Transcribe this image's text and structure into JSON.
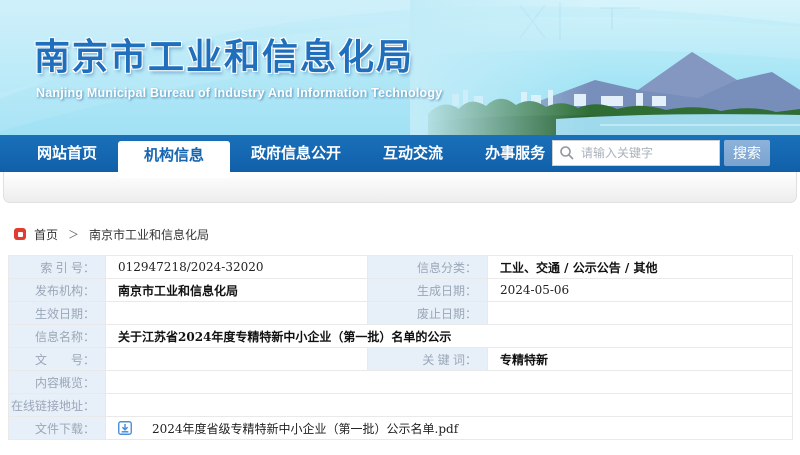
{
  "header": {
    "title": "南京市工业和信息化局",
    "subtitle": "Nanjing Municipal Bureau of Industry And Information Technology"
  },
  "nav": {
    "items": [
      "网站首页",
      "机构信息",
      "政府信息公开",
      "互动交流",
      "办事服务"
    ],
    "active_item": "机构信息",
    "search_placeholder": "请输入关键字",
    "search_button": "搜索"
  },
  "breadcrumb": {
    "home": "首页",
    "separator": "＞",
    "current": "南京市工业和信息化局"
  },
  "record": {
    "labels": {
      "index": "索 引 号：",
      "category": "信息分类：",
      "publisher": "发布机构：",
      "created": "生成日期：",
      "effective": "生效日期：",
      "expiry": "废止日期：",
      "title": "信息名称：",
      "doc_no": "文　　号：",
      "keywords": "关 键 词：",
      "summary": "内容概览：",
      "link": "在线链接地址：",
      "download": "文件下载："
    },
    "values": {
      "index": "012947218/2024-32020",
      "category": "工业、交通 / 公示公告 / 其他",
      "publisher": "南京市工业和信息化局",
      "created": "2024-05-06",
      "effective": "",
      "expiry": "",
      "title": "关于江苏省2024年度专精特新中小企业（第一批）名单的公示",
      "doc_no": "",
      "keywords": "专精特新",
      "summary": "",
      "link": "",
      "download_file": "2024年度省级专精特新中小企业（第一批）公示名单.pdf"
    }
  },
  "colors": {
    "nav_blue": "#1565b0",
    "label_cell_bg": "#e7eff8",
    "label_text": "#9aa7b8",
    "accent_red": "#e23b31",
    "download_icon_blue": "#4a8fdb",
    "search_button_blue": "#7aa3cf"
  }
}
